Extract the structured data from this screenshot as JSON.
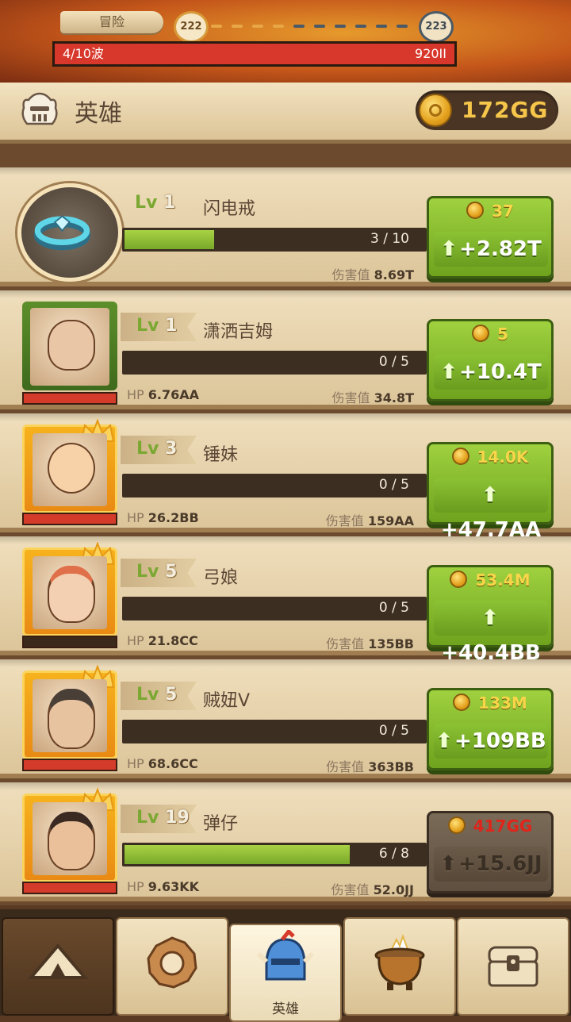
{
  "top": {
    "adventure_label": "冒险",
    "wave_current": "222",
    "wave_next": "223",
    "wave_progress": "4/10波",
    "boss_hp": "920II"
  },
  "header": {
    "title": "英雄",
    "gold": "172GG"
  },
  "rows": [
    {
      "type": "artifact",
      "level_label": "Lv",
      "level": "1",
      "name": "闪电戒",
      "xp": "3 / 10",
      "xp_fraction": 0.3,
      "hp_label": "",
      "hp": "",
      "dmg_label": "伤害值",
      "dmg": "8.69T",
      "cost": "37",
      "gain": "+2.82T",
      "affordable": true
    },
    {
      "type": "hero",
      "level_label": "Lv",
      "level": "1",
      "name": "潇洒吉姆",
      "xp": "0 / 5",
      "xp_fraction": 0,
      "hp_label": "HP",
      "hp": "6.76AA",
      "dmg_label": "伤害值",
      "dmg": "34.8T",
      "cost": "5",
      "gain": "+10.4T",
      "affordable": true
    },
    {
      "type": "hero",
      "level_label": "Lv",
      "level": "3",
      "name": "锤妹",
      "xp": "0 / 5",
      "xp_fraction": 0,
      "hp_label": "HP",
      "hp": "26.2BB",
      "dmg_label": "伤害值",
      "dmg": "159AA",
      "cost": "14.0K",
      "gain": "+47.7AA",
      "affordable": true
    },
    {
      "type": "hero",
      "level_label": "Lv",
      "level": "5",
      "name": "弓娘",
      "xp": "0 / 5",
      "xp_fraction": 0,
      "hp_label": "HP",
      "hp": "21.8CC",
      "dmg_label": "伤害值",
      "dmg": "135BB",
      "cost": "53.4M",
      "gain": "+40.4BB",
      "affordable": true
    },
    {
      "type": "hero",
      "level_label": "Lv",
      "level": "5",
      "name": "贼妞V",
      "xp": "0 / 5",
      "xp_fraction": 0,
      "hp_label": "HP",
      "hp": "68.6CC",
      "dmg_label": "伤害值",
      "dmg": "363BB",
      "cost": "133M",
      "gain": "+109BB",
      "affordable": true
    },
    {
      "type": "hero",
      "level_label": "Lv",
      "level": "19",
      "name": "弹仔",
      "xp": "6 / 8",
      "xp_fraction": 0.75,
      "hp_label": "HP",
      "hp": "9.63KK",
      "dmg_label": "伤害值",
      "dmg": "52.0JJ",
      "cost": "417GG",
      "gain": "+15.6JJ",
      "affordable": false
    }
  ],
  "nav": {
    "items": [
      {
        "icon": "tent-icon",
        "label": ""
      },
      {
        "icon": "gear-stone-icon",
        "label": ""
      },
      {
        "icon": "knight-helmet-icon",
        "label": "英雄"
      },
      {
        "icon": "cauldron-icon",
        "label": ""
      },
      {
        "icon": "treasure-chest-icon",
        "label": ""
      }
    ]
  },
  "colors": {
    "accent_green": "#8cc334",
    "gold_text": "#f6c64a",
    "hp_red": "#d8382b",
    "unaffordable_red": "#e0241a"
  }
}
